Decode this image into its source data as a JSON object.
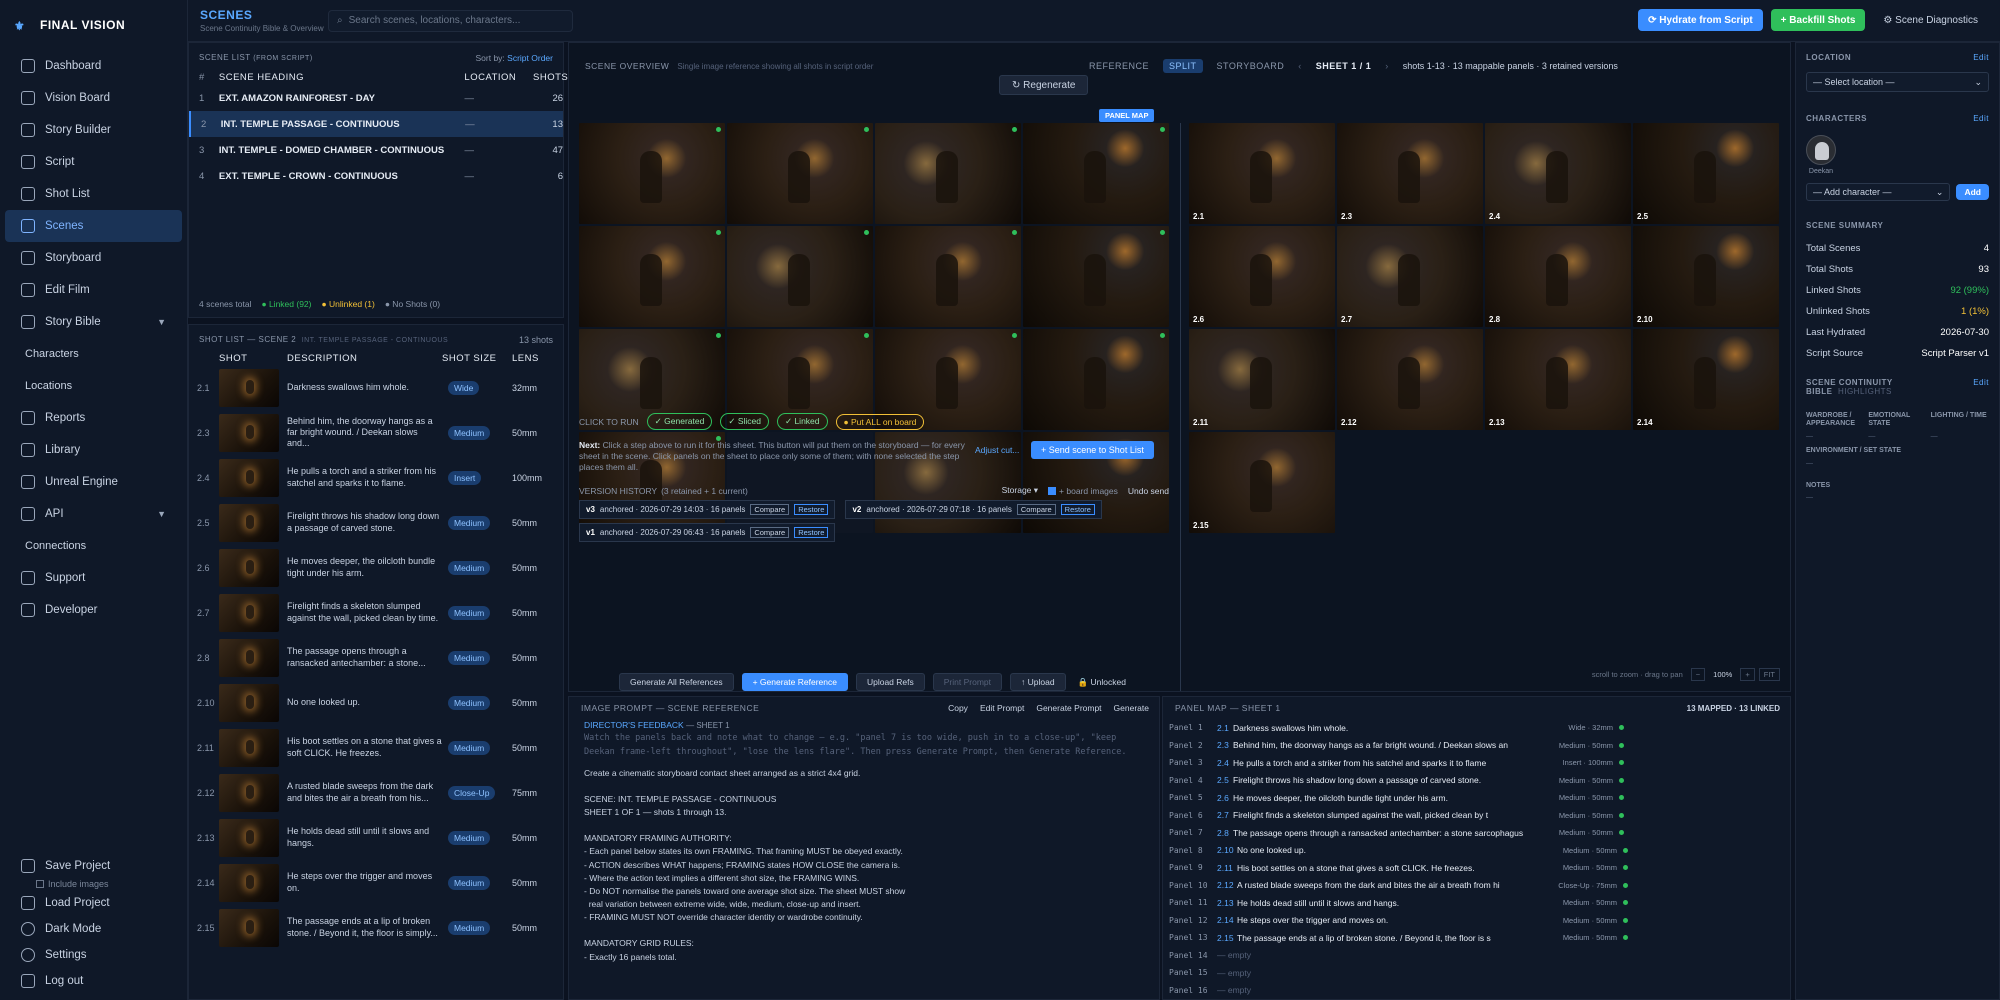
{
  "brand": "FINAL VISION",
  "nav": {
    "items": [
      {
        "label": "Dashboard",
        "icon": "dashboard-icon"
      },
      {
        "label": "Vision Board",
        "icon": "vision-board-icon"
      },
      {
        "label": "Story Builder",
        "icon": "story-builder-icon"
      },
      {
        "label": "Script",
        "icon": "script-icon"
      },
      {
        "label": "Shot List",
        "icon": "shot-list-icon"
      },
      {
        "label": "Scenes",
        "icon": "scenes-icon"
      },
      {
        "label": "Storyboard",
        "icon": "storyboard-icon"
      },
      {
        "label": "Edit Film",
        "icon": "edit-film-icon"
      },
      {
        "label": "Story Bible",
        "icon": "story-bible-icon"
      },
      {
        "label": "Characters"
      },
      {
        "label": "Locations"
      },
      {
        "label": "Reports",
        "icon": "reports-icon"
      },
      {
        "label": "Library",
        "icon": "library-icon"
      },
      {
        "label": "Unreal Engine",
        "icon": "unreal-engine-icon"
      },
      {
        "label": "API",
        "icon": "api-icon"
      },
      {
        "label": "Connections"
      },
      {
        "label": "Support",
        "icon": "support-icon"
      },
      {
        "label": "Developer",
        "icon": "developer-icon"
      }
    ],
    "active": "Scenes",
    "bottom": {
      "save": "Save Project",
      "include": "Include images",
      "load": "Load Project",
      "dark": "Dark Mode",
      "settings": "Settings",
      "logout": "Log out"
    }
  },
  "topbar": {
    "title": "SCENES",
    "subtitle": "Scene Continuity Bible & Overview",
    "search_placeholder": "Search scenes, locations, characters...",
    "hydrate": "Hydrate from Script",
    "backfill": "Backfill Shots",
    "diagnostics": "Scene Diagnostics"
  },
  "scene_list": {
    "title": "SCENE LIST",
    "from": "(FROM SCRIPT)",
    "sort_label": "Sort by:",
    "sort_value": "Script Order",
    "cols": {
      "num": "#",
      "heading": "SCENE HEADING",
      "location": "LOCATION",
      "shots": "SHOTS"
    },
    "rows": [
      {
        "num": "1",
        "heading": "EXT. AMAZON RAINFOREST - DAY",
        "location": "—",
        "shots": "26"
      },
      {
        "num": "2",
        "heading": "INT. TEMPLE PASSAGE - CONTINUOUS",
        "location": "—",
        "shots": "13"
      },
      {
        "num": "3",
        "heading": "INT. TEMPLE - DOMED CHAMBER - CONTINUOUS",
        "location": "—",
        "shots": "47"
      },
      {
        "num": "4",
        "heading": "EXT. TEMPLE - CROWN - CONTINUOUS",
        "location": "—",
        "shots": "6"
      }
    ],
    "footer": {
      "total": "4 scenes total",
      "linked": "● Linked (92)",
      "unlinked": "● Unlinked (1)",
      "noshots": "● No Shots (0)"
    }
  },
  "shot_list": {
    "title": "SHOT LIST — SCENE 2",
    "scene": "INT. TEMPLE PASSAGE - CONTINUOUS",
    "count": "13 shots",
    "cols": {
      "shot": "SHOT",
      "desc": "DESCRIPTION",
      "size": "SHOT SIZE",
      "lens": "LENS"
    },
    "rows": [
      {
        "n": "2.1",
        "d": "Darkness swallows him whole.",
        "s": "Wide",
        "l": "32mm"
      },
      {
        "n": "2.3",
        "d": "Behind him, the doorway hangs as a far bright wound. / Deekan slows and...",
        "s": "Medium",
        "l": "50mm"
      },
      {
        "n": "2.4",
        "d": "He pulls a torch and a striker from his satchel and sparks it to flame.",
        "s": "Insert",
        "l": "100mm"
      },
      {
        "n": "2.5",
        "d": "Firelight throws his shadow long down a passage of carved stone.",
        "s": "Medium",
        "l": "50mm"
      },
      {
        "n": "2.6",
        "d": "He moves deeper, the oilcloth bundle tight under his arm.",
        "s": "Medium",
        "l": "50mm"
      },
      {
        "n": "2.7",
        "d": "Firelight finds a skeleton slumped against the wall, picked clean by time.",
        "s": "Medium",
        "l": "50mm"
      },
      {
        "n": "2.8",
        "d": "The passage opens through a ransacked antechamber: a stone...",
        "s": "Medium",
        "l": "50mm"
      },
      {
        "n": "2.10",
        "d": "No one looked up.",
        "s": "Medium",
        "l": "50mm"
      },
      {
        "n": "2.11",
        "d": "His boot settles on a stone that gives a soft CLICK. He freezes.",
        "s": "Medium",
        "l": "50mm"
      },
      {
        "n": "2.12",
        "d": "A rusted blade sweeps from the dark and bites the air a breath from his...",
        "s": "Close-Up",
        "l": "75mm"
      },
      {
        "n": "2.13",
        "d": "He holds dead still until it slows and hangs.",
        "s": "Medium",
        "l": "50mm"
      },
      {
        "n": "2.14",
        "d": "He steps over the trigger and moves on.",
        "s": "Medium",
        "l": "50mm"
      },
      {
        "n": "2.15",
        "d": "The passage ends at a lip of broken stone. / Beyond it, the floor is simply...",
        "s": "Medium",
        "l": "50mm"
      }
    ]
  },
  "overview": {
    "title": "SCENE OVERVIEW",
    "subtitle": "Single image reference showing all shots in script order",
    "regenerate": "↻ Regenerate",
    "modes": [
      "REFERENCE",
      "SPLIT",
      "STORYBOARD"
    ],
    "active_mode": "SPLIT",
    "sheet": "SHEET 1 / 1",
    "sheet_info": "shots 1-13 · 13 mappable panels · 3 retained versions",
    "panel_map_badge": "PANEL MAP",
    "right_labels": [
      "2.1",
      "2.3",
      "2.4",
      "2.5",
      "2.6",
      "2.7",
      "2.8",
      "2.10",
      "2.11",
      "2.12",
      "2.13",
      "2.14",
      "2.15"
    ],
    "click_to_run": "CLICK TO RUN",
    "tags": [
      "Generated",
      "Sliced",
      "Linked",
      "Put ALL on board"
    ],
    "next_label": "Next:",
    "next_text": "Click a step above to run it for this sheet. This button will put them on the storyboard — for every sheet in the scene. Click panels on the sheet to place only some of them; with none selected the step places them all.",
    "adjust": "Adjust cut...",
    "send": "+ Send scene to Shot List",
    "version_history": "VERSION HISTORY",
    "version_meta": "(3 retained + 1 current)",
    "storage": "Storage ▾",
    "board_images": "+ board images",
    "undo": "Undo send",
    "versions": [
      {
        "v": "v3",
        "t": "anchored · 2026-07-29 14:03 · 16 panels"
      },
      {
        "v": "v2",
        "t": "anchored · 2026-07-29 07:18 · 16 panels"
      },
      {
        "v": "v1",
        "t": "anchored · 2026-07-29 06:43 · 16 panels"
      }
    ],
    "compare": "Compare",
    "restore": "Restore",
    "bottom": [
      "Generate All References",
      "+ Generate Reference",
      "Upload Refs",
      "Print Prompt",
      "↑ Upload",
      "🔒 Unlocked"
    ],
    "zoom": {
      "hint": "scroll to zoom · drag to pan",
      "minus": "−",
      "value": "100%",
      "plus": "+",
      "fit": "FIT"
    }
  },
  "prompt": {
    "title": "IMAGE PROMPT — SCENE REFERENCE",
    "actions": [
      "Copy",
      "Edit Prompt",
      "Generate Prompt",
      "Generate"
    ],
    "feedback_label": "DIRECTOR'S FEEDBACK",
    "feedback_sheet": "— SHEET 1",
    "feedback_placeholder": "Watch the panels back and note what to change — e.g. \"panel 7 is too wide, push in to a close-up\", \"keep Deekan frame-left throughout\", \"lose the lens flare\". Then press Generate Prompt, then Generate Reference.",
    "lines": [
      "Create a cinematic storyboard contact sheet arranged as a strict 4x4 grid.",
      "",
      "SCENE: INT. TEMPLE PASSAGE - CONTINUOUS",
      "SHEET 1 OF 1 — shots 1 through 13.",
      "",
      "MANDATORY FRAMING AUTHORITY:",
      "- Each panel below states its own FRAMING. That framing MUST be obeyed exactly.",
      "- ACTION describes WHAT happens; FRAMING states HOW CLOSE the camera is.",
      "- Where the action text implies a different shot size, the FRAMING WINS.",
      "- Do NOT normalise the panels toward one average shot size. The sheet MUST show",
      "  real variation between extreme wide, wide, medium, close-up and insert.",
      "- FRAMING MUST NOT override character identity or wardrobe continuity.",
      "",
      "MANDATORY GRID RULES:",
      "- Exactly 16 panels total."
    ]
  },
  "panel_map": {
    "title": "PANEL MAP",
    "sheet": "— SHEET 1",
    "stats": "13 MAPPED · 13 LINKED",
    "rows": [
      {
        "p": "Panel 1",
        "n": "2.1",
        "d": "Darkness swallows him whole.",
        "s": "Wide · 32mm"
      },
      {
        "p": "Panel 2",
        "n": "2.3",
        "d": "Behind him, the doorway hangs as a far bright wound. / Deekan slows an",
        "s": "Medium · 50mm"
      },
      {
        "p": "Panel 3",
        "n": "2.4",
        "d": "He pulls a torch and a striker from his satchel and sparks it to flame",
        "s": "Insert · 100mm"
      },
      {
        "p": "Panel 4",
        "n": "2.5",
        "d": "Firelight throws his shadow long down a passage of carved stone.",
        "s": "Medium · 50mm"
      },
      {
        "p": "Panel 5",
        "n": "2.6",
        "d": "He moves deeper, the oilcloth bundle tight under his arm.",
        "s": "Medium · 50mm"
      },
      {
        "p": "Panel 6",
        "n": "2.7",
        "d": "Firelight finds a skeleton slumped against the wall, picked clean by t",
        "s": "Medium · 50mm"
      },
      {
        "p": "Panel 7",
        "n": "2.8",
        "d": "The passage opens through a ransacked antechamber: a stone sarcophagus",
        "s": "Medium · 50mm"
      },
      {
        "p": "Panel 8",
        "n": "2.10",
        "d": "No one looked up.",
        "s": "Medium · 50mm"
      },
      {
        "p": "Panel 9",
        "n": "2.11",
        "d": "His boot settles on a stone that gives a soft CLICK. He freezes.",
        "s": "Medium · 50mm"
      },
      {
        "p": "Panel 10",
        "n": "2.12",
        "d": "A rusted blade sweeps from the dark and bites the air a breath from hi",
        "s": "Close-Up · 75mm"
      },
      {
        "p": "Panel 11",
        "n": "2.13",
        "d": "He holds dead still until it slows and hangs.",
        "s": "Medium · 50mm"
      },
      {
        "p": "Panel 12",
        "n": "2.14",
        "d": "He steps over the trigger and moves on.",
        "s": "Medium · 50mm"
      },
      {
        "p": "Panel 13",
        "n": "2.15",
        "d": "The passage ends at a lip of broken stone. / Beyond it, the floor is s",
        "s": "Medium · 50mm"
      },
      {
        "p": "Panel 14",
        "n": "",
        "d": "— empty",
        "s": ""
      },
      {
        "p": "Panel 15",
        "n": "",
        "d": "— empty",
        "s": ""
      },
      {
        "p": "Panel 16",
        "n": "",
        "d": "— empty",
        "s": ""
      }
    ]
  },
  "right": {
    "location": "LOCATION",
    "edit": "Edit",
    "select_location": "— Select location —",
    "characters": "CHARACTERS",
    "character_name": "Deekan",
    "add_character": "— Add character —",
    "add": "Add",
    "summary_title": "SCENE SUMMARY",
    "summary": [
      {
        "k": "Total Scenes",
        "v": "4",
        "c": "#ffffff"
      },
      {
        "k": "Total Shots",
        "v": "93",
        "c": "#ffffff"
      },
      {
        "k": "Linked Shots",
        "v": "92 (99%)",
        "c": "#2fbf5b"
      },
      {
        "k": "Unlinked Shots",
        "v": "1 (1%)",
        "c": "#f2c037"
      },
      {
        "k": "Last Hydrated",
        "v": "2026-07-30",
        "c": "#ffffff"
      },
      {
        "k": "Script Source",
        "v": "Script Parser v1",
        "c": "#ffffff"
      }
    ],
    "bible_title": "SCENE CONTINUITY BIBLE",
    "highlights": "HIGHLIGHTS",
    "bible_cols": [
      "WARDROBE / APPEARANCE",
      "EMOTIONAL STATE",
      "LIGHTING / TIME"
    ],
    "env": "ENVIRONMENT / SET STATE",
    "notes": "NOTES",
    "dash": "—"
  }
}
